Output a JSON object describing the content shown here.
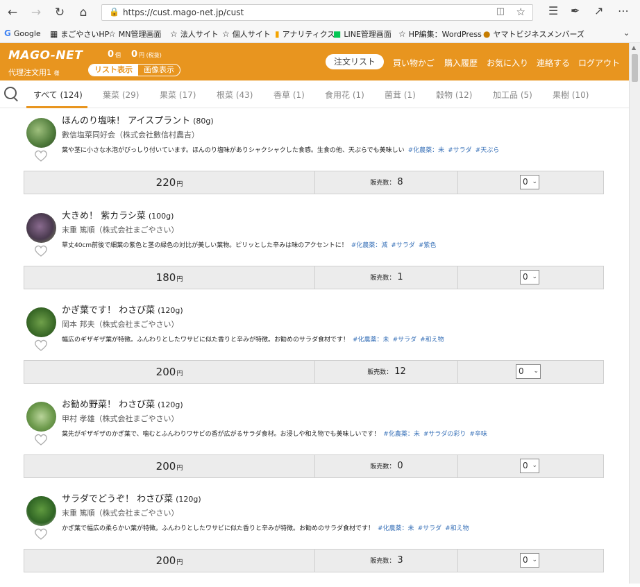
{
  "browser": {
    "url": "https://cust.mago-net.jp/cust",
    "bookmarks": [
      "Google",
      "まごやさいHP",
      "MN管理画面",
      "法人サイト",
      "個人サイト",
      "アナリティクス",
      "LINE管理画面",
      "HP編集：WordPress",
      "ヤマトビジネスメンバーズ"
    ]
  },
  "header": {
    "logo": "MAGO-NET",
    "agent_name": "代理注文用1",
    "agent_suffix": "様",
    "cart_count": "0",
    "cart_count_unit": "個",
    "cart_total": "0",
    "cart_total_unit": "円 (税抜)",
    "view_list": "リスト表示",
    "view_image": "画像表示",
    "order_list_button": "注文リスト",
    "nav": [
      "買い物かご",
      "購入履歴",
      "お気に入り",
      "連絡する",
      "ログアウト"
    ]
  },
  "tabs": [
    {
      "label": "すべて (124)"
    },
    {
      "label": "葉菜 (29)"
    },
    {
      "label": "果菜 (17)"
    },
    {
      "label": "根菜 (43)"
    },
    {
      "label": "香草 (1)"
    },
    {
      "label": "食用花 (1)"
    },
    {
      "label": "菌茸 (1)"
    },
    {
      "label": "穀物 (12)"
    },
    {
      "label": "加工品 (5)"
    },
    {
      "label": "果樹 (10)"
    }
  ],
  "products": [
    {
      "name": "ほんのり塩味！ アイスプラント",
      "weight": "(80g)",
      "producer": "數信塩菜同好会（株式会社數信村農吉）",
      "desc": "葉や茎に小さな水泡がびっしり付いています。ほんのり塩味がありシャクシャクした食感。生食の他、天ぷらでも美味しい",
      "tags": [
        "#化農薬：未",
        "#サラダ",
        "#天ぷら"
      ],
      "price": "220",
      "price_unit": "円",
      "sold_label": "販売数：",
      "sold": "8",
      "qty": "0"
    },
    {
      "name": "大きめ！ 紫カラシ菜",
      "weight": "(100g)",
      "producer": "末重 篤順（株式会社まごやさい）",
      "desc": "草丈40cm前後で細葉の紫色と茎の緑色の対比が美しい葉物。ピリッとした辛みは味のアクセントに！",
      "tags": [
        "#化農薬：減",
        "#サラダ",
        "#紫色"
      ],
      "price": "180",
      "price_unit": "円",
      "sold_label": "販売数：",
      "sold": "1",
      "qty": "0"
    },
    {
      "name": "かぎ葉です！ わさび菜",
      "weight": "(120g)",
      "producer": "岡本 邦夫（株式会社まごやさい）",
      "desc": "幅広のギザギザ葉が特徴。ふんわりとしたワサビに似た香りと辛みが特徴。お勧めのサラダ食材です！",
      "tags": [
        "#化農薬：未",
        "#サラダ",
        "#和え物"
      ],
      "price": "200",
      "price_unit": "円",
      "sold_label": "販売数：",
      "sold": "12",
      "qty": "0"
    },
    {
      "name": "お勧め野菜！ わさび菜",
      "weight": "(120g)",
      "producer": "甲村 孝雄（株式会社まごやさい）",
      "desc": "葉先がギザギザのかぎ葉で、噛むとふんわりワサビの香が広がるサラダ食材。お浸しや和え物でも美味しいです！",
      "tags": [
        "#化農薬：未",
        "#サラダの彩り",
        "#辛味"
      ],
      "price": "200",
      "price_unit": "円",
      "sold_label": "販売数：",
      "sold": "0",
      "qty": "0"
    },
    {
      "name": "サラダでどうぞ！ わさび菜",
      "weight": "(120g)",
      "producer": "末重 篤順（株式会社まごやさい）",
      "desc": "かぎ葉で幅広の柔らかい葉が特徴。ふんわりとしたワサビに似た香りと辛みが特徴。お勧めのサラダ食材です！",
      "tags": [
        "#化農薬：未",
        "#サラダ",
        "#和え物"
      ],
      "price": "200",
      "price_unit": "円",
      "sold_label": "販売数：",
      "sold": "3",
      "qty": "0"
    }
  ],
  "colors": {
    "brand": "#e8951f",
    "tag": "#3b73b9",
    "price_bar": "#ececec"
  }
}
